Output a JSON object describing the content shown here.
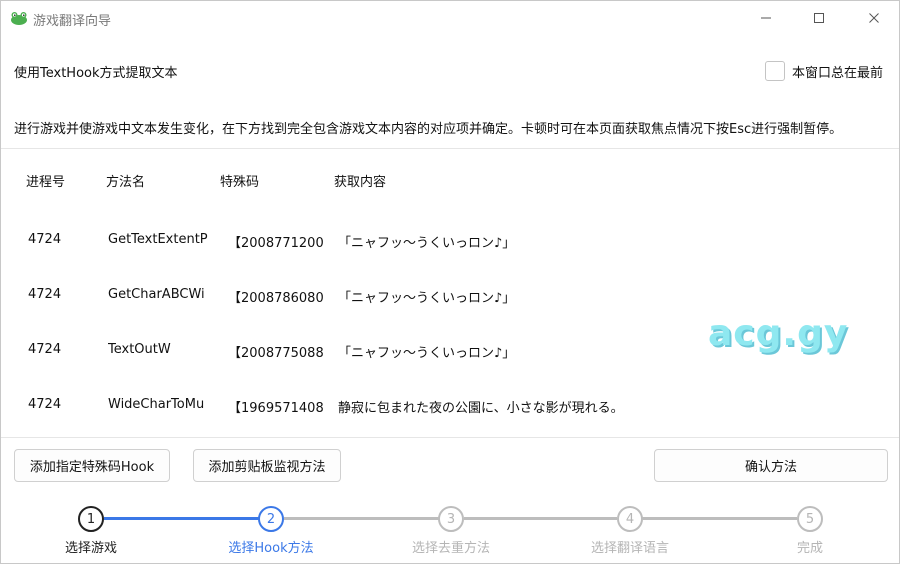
{
  "window": {
    "title": "游戏翻译向导",
    "icon": "frog-app-icon",
    "controls": [
      "minimize-icon",
      "maximize-icon",
      "close-icon"
    ]
  },
  "header": {
    "mode_label": "使用TextHook方式提取文本",
    "topmost_label": "本窗口总在最前",
    "topmost_checked": false,
    "instruction": "进行游戏并使游戏中文本发生变化，在下方找到完全包含游戏文本内容的对应项并确定。卡顿时可在本页面获取焦点情况下按Esc进行强制暂停。"
  },
  "table": {
    "columns": [
      "进程号",
      "方法名",
      "特殊码",
      "获取内容"
    ],
    "rows": [
      {
        "pid": "4724",
        "method": "GetTextExtentP",
        "code": "【2008771200:",
        "content": "「ニャフッ～うくいっロン♪」"
      },
      {
        "pid": "4724",
        "method": "GetCharABCWi",
        "code": "【2008786080:",
        "content": "「ニャフッ～うくいっロン♪」"
      },
      {
        "pid": "4724",
        "method": "TextOutW",
        "code": "【2008775088:",
        "content": "「ニャフッ～うくいっロン♪」"
      },
      {
        "pid": "4724",
        "method": "WideCharToMu",
        "code": "【1969571408:",
        "content": "静寂に包まれた夜の公園に、小さな影が現れる。"
      }
    ]
  },
  "watermark": "acg.gy",
  "buttons": {
    "add_hook": "添加指定特殊码Hook",
    "add_clipboard": "添加剪贴板监视方法",
    "confirm": "确认方法"
  },
  "steps": {
    "current": 2,
    "items": [
      {
        "num": "1",
        "label": "选择游戏"
      },
      {
        "num": "2",
        "label": "选择Hook方法"
      },
      {
        "num": "3",
        "label": "选择去重方法"
      },
      {
        "num": "4",
        "label": "选择翻译语言"
      },
      {
        "num": "5",
        "label": "完成"
      }
    ]
  },
  "colors": {
    "accent": "#3b78e7",
    "done": "#222222",
    "pending": "#bdbdbd",
    "pending_text": "#b5b5b5"
  }
}
